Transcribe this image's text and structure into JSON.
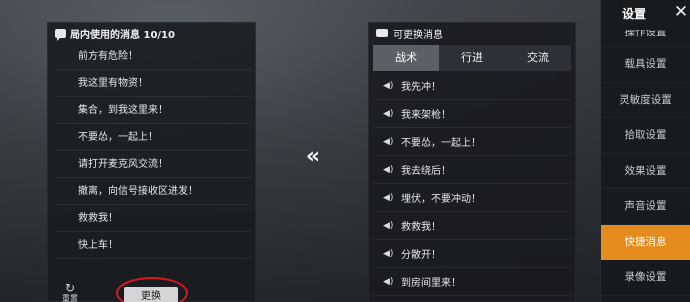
{
  "used_panel": {
    "title": "局内使用的消息 10/10",
    "items": [
      "前方有危险！",
      "我这里有物资！",
      "集合，到我这里来！",
      "不要怂，一起上！",
      "请打开麦克风交流！",
      "撤离，向信号接收区进发！",
      "救救我！",
      "快上车！"
    ],
    "reset_label": "重置",
    "reset_icon": "refresh-icon",
    "replace_label": "更换"
  },
  "swap_arrow_glyph": "«",
  "available_panel": {
    "title": "可更换消息",
    "tabs": [
      {
        "label": "战术",
        "active": true
      },
      {
        "label": "行进",
        "active": false
      },
      {
        "label": "交流",
        "active": false
      }
    ],
    "items": [
      "我先冲！",
      "我来架枪！",
      "不要怂，一起上！",
      "我去绕后！",
      "埋伏，不要冲动！",
      "救救我！",
      "分散开！",
      "到房间里来！"
    ],
    "item_icon": "speaker-icon"
  },
  "sidebar": {
    "title": "设置",
    "close_glyph": "✕",
    "items": [
      {
        "label": "操作设置",
        "active": false
      },
      {
        "label": "载具设置",
        "active": false
      },
      {
        "label": "灵敏度设置",
        "active": false
      },
      {
        "label": "拾取设置",
        "active": false
      },
      {
        "label": "效果设置",
        "active": false
      },
      {
        "label": "声音设置",
        "active": false
      },
      {
        "label": "快捷消息",
        "active": true
      },
      {
        "label": "录像设置",
        "active": false
      }
    ]
  },
  "colors": {
    "accent_orange": "#e58a1c",
    "highlight_red": "#d8161e"
  }
}
